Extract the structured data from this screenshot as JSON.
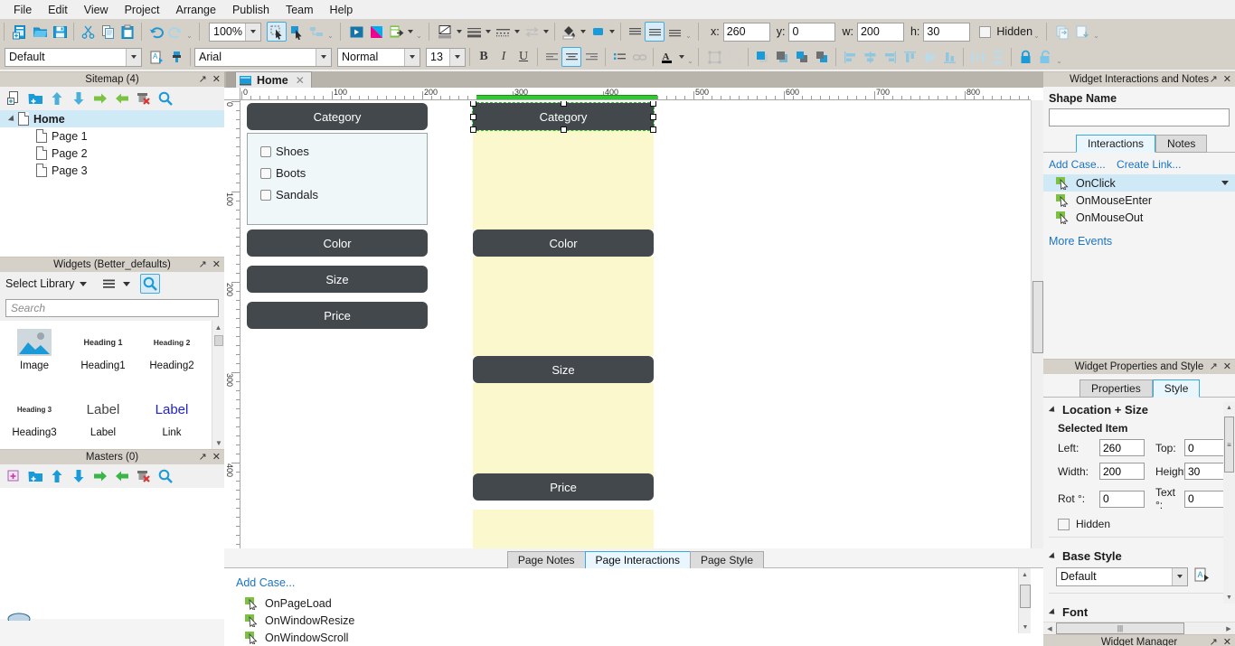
{
  "menu": [
    "File",
    "Edit",
    "View",
    "Project",
    "Arrange",
    "Publish",
    "Team",
    "Help"
  ],
  "toolbar": {
    "zoom_value": "100%",
    "style_value": "Default",
    "font_value": "Arial",
    "weight_value": "Normal",
    "size_value": "13",
    "coords": {
      "x_label": "x:",
      "x_value": "260",
      "y_label": "y:",
      "y_value": "0",
      "w_label": "w:",
      "w_value": "200",
      "h_label": "h:",
      "h_value": "30",
      "hidden_label": "Hidden"
    },
    "icons_row1": [
      "new-page-icon",
      "open-file-icon",
      "save-icon",
      "cut-icon",
      "copy-icon",
      "paste-icon",
      "undo-icon",
      "redo-icon",
      "select-mode-icon",
      "connector-mode-icon",
      "snap-icon",
      "preview-icon",
      "generate-html-icon",
      "generate-word-icon"
    ],
    "icons_row2": [
      "style-paint-icon",
      "format-painter-icon",
      "bold-icon",
      "italic-icon",
      "underline-icon",
      "align-left-icon",
      "align-center-icon",
      "align-right-icon",
      "bullet-list-icon",
      "link-icon",
      "font-color-icon",
      "group-icon",
      "ungroup-icon",
      "bring-front-icon",
      "send-back-icon",
      "bring-forward-icon",
      "send-backward-icon",
      "align-left-obj-icon",
      "align-center-obj-icon",
      "align-right-obj-icon",
      "align-top-icon",
      "align-middle-icon",
      "align-bottom-icon",
      "distribute-h-icon",
      "distribute-v-icon",
      "lock-icon",
      "unlock-icon"
    ]
  },
  "sitemap": {
    "title": "Sitemap (4)",
    "toolbar_icons": [
      "add-page-icon",
      "add-folder-icon",
      "move-up-icon",
      "move-down-icon",
      "indent-icon",
      "outdent-icon",
      "delete-icon",
      "search-icon"
    ],
    "items": [
      {
        "label": "Home",
        "depth": 0,
        "selected": true,
        "expander": true
      },
      {
        "label": "Page 1",
        "depth": 1,
        "selected": false,
        "expander": false
      },
      {
        "label": "Page 2",
        "depth": 1,
        "selected": false,
        "expander": false
      },
      {
        "label": "Page 3",
        "depth": 1,
        "selected": false,
        "expander": false
      }
    ]
  },
  "widgets_panel": {
    "title": "Widgets (Better_defaults)",
    "select_library_label": "Select Library",
    "search_placeholder": "Search",
    "items": [
      {
        "name": "Image",
        "preview": "image-thumb"
      },
      {
        "name": "Heading1",
        "preview": "Heading 1"
      },
      {
        "name": "Heading2",
        "preview": "Heading 2"
      },
      {
        "name": "Heading3",
        "preview": "Heading 3"
      },
      {
        "name": "Label",
        "preview": "Label"
      },
      {
        "name": "Link",
        "preview": "Label"
      }
    ]
  },
  "masters_panel": {
    "title": "Masters (0)",
    "toolbar_icons": [
      "add-master-icon",
      "add-folder-icon",
      "move-up-icon",
      "move-down-icon",
      "indent-icon",
      "outdent-icon",
      "delete-icon",
      "search-icon"
    ]
  },
  "canvas": {
    "tab_label": "Home",
    "ruler_h_labels": [
      "0",
      "100",
      "200",
      "300",
      "400",
      "500",
      "600",
      "700",
      "800"
    ],
    "ruler_v_labels": [
      "0",
      "100",
      "200",
      "300",
      "400"
    ],
    "selection": {
      "left": "260",
      "top": "0",
      "width": "200",
      "height": "30"
    },
    "left_column": {
      "header": "Category",
      "checkboxes": [
        "Shoes",
        "Boots",
        "Sandals"
      ],
      "buttons": [
        "Color",
        "Size",
        "Price"
      ]
    },
    "right_column": {
      "buttons": [
        "Category",
        "Color",
        "Size",
        "Price"
      ]
    }
  },
  "bottom_panel": {
    "tabs": [
      {
        "label": "Page Notes",
        "selected": false
      },
      {
        "label": "Page Interactions",
        "selected": true
      },
      {
        "label": "Page Style",
        "selected": false
      }
    ],
    "add_case_label": "Add Case...",
    "events": [
      "OnPageLoad",
      "OnWindowResize",
      "OnWindowScroll"
    ]
  },
  "right_panel": {
    "interactions": {
      "title": "Widget Interactions and Notes",
      "shape_name_label": "Shape Name",
      "shape_name_value": "",
      "tabs": [
        {
          "label": "Interactions",
          "selected": true
        },
        {
          "label": "Notes",
          "selected": false
        }
      ],
      "add_case_label": "Add Case...",
      "create_link_label": "Create Link...",
      "events": [
        {
          "label": "OnClick",
          "selected": true
        },
        {
          "label": "OnMouseEnter",
          "selected": false
        },
        {
          "label": "OnMouseOut",
          "selected": false
        }
      ],
      "more_events_label": "More Events"
    },
    "properties": {
      "title": "Widget Properties and Style",
      "tabs": [
        {
          "label": "Properties",
          "selected": false
        },
        {
          "label": "Style",
          "selected": true
        }
      ],
      "location_size_label": "Location + Size",
      "selected_item_label": "Selected Item",
      "fields": [
        {
          "label": "Left:",
          "value": "260"
        },
        {
          "label": "Top:",
          "value": "0"
        },
        {
          "label": "Width:",
          "value": "200"
        },
        {
          "label": "Height:",
          "value": "30"
        },
        {
          "label": "Rot °:",
          "value": "0"
        },
        {
          "label": "Text °:",
          "value": "0"
        }
      ],
      "hidden_label": "Hidden",
      "base_style_label": "Base Style",
      "base_style_value": "Default",
      "font_label": "Font"
    },
    "widget_manager": {
      "title": "Widget Manager"
    }
  },
  "colors": {
    "accent": "#37aadd",
    "link": "#1a74c4",
    "selection_row": "#cfe9f7",
    "widget_dark": "#42484b",
    "panel_light": "#f0f7f9",
    "panel_yellow": "#fbf8cd",
    "selection_green": "#22c522",
    "chrome": "#d5d1c9"
  }
}
